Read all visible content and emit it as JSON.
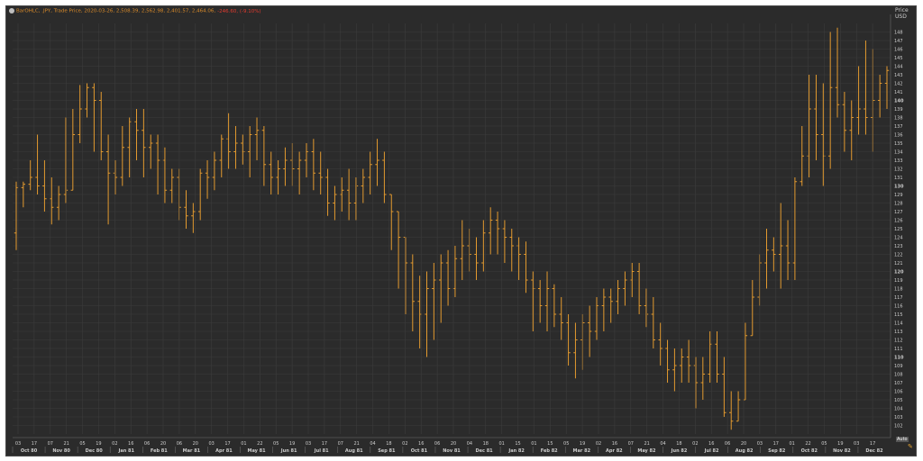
{
  "legend": {
    "instrument": "BarOHLC, .JPY, Trade Price, 2020-03-26, 2,508.39, 2,562.98, 2,401.57, 2,464.06,",
    "change": "-246.60, (-9.10%)"
  },
  "price_axis": {
    "title": "Price",
    "currency": "USD"
  },
  "scale_tag": "Auto",
  "colors": {
    "background": "#2b2b2b",
    "grid": "#3c3c3c",
    "bars": "#e39a2f",
    "text": "#cccccc",
    "change": "#e23b2e"
  },
  "chart_data": {
    "type": "ohlc",
    "title": "",
    "xlabel": "",
    "ylabel": "Price",
    "ylim": [
      101,
      149
    ],
    "yticks": [
      102,
      103,
      104,
      105,
      106,
      107,
      108,
      109,
      110,
      111,
      112,
      113,
      114,
      115,
      116,
      117,
      118,
      119,
      120,
      121,
      122,
      123,
      124,
      125,
      126,
      127,
      128,
      129,
      130,
      131,
      132,
      133,
      134,
      135,
      136,
      137,
      138,
      139,
      140,
      141,
      142,
      143,
      144,
      145,
      146,
      147,
      148
    ],
    "ytick_bold": [
      110,
      120,
      130,
      140
    ],
    "day_ticks": [
      "03",
      "17",
      "07",
      "21",
      "05",
      "19",
      "02",
      "16",
      "06",
      "20",
      "06",
      "20",
      "03",
      "17",
      "01",
      "22",
      "05",
      "19",
      "03",
      "17",
      "07",
      "21",
      "04",
      "18",
      "02",
      "16",
      "06",
      "20",
      "04",
      "18",
      "01",
      "15",
      "01",
      "15",
      "05",
      "19",
      "02",
      "16",
      "07",
      "21",
      "04",
      "18",
      "02",
      "16",
      "06",
      "20",
      "03",
      "17",
      "01",
      "22",
      "05",
      "19",
      "03",
      "17"
    ],
    "months": [
      "Oct 80",
      "Nov 80",
      "Dec 80",
      "Jan 81",
      "Feb 81",
      "Mar 81",
      "Apr 81",
      "May 81",
      "Jun 81",
      "Jul 81",
      "Aug 81",
      "Sep 81",
      "Oct 81",
      "Nov 81",
      "Dec 81",
      "Jan 82",
      "Feb 82",
      "Mar 82",
      "Apr 82",
      "May 82",
      "Jun 82",
      "Jul 82",
      "Aug 82",
      "Sep 82",
      "Oct 82",
      "Nov 82",
      "Dec 82"
    ],
    "bars": [
      [
        124.5,
        130.5,
        122.5,
        129.8
      ],
      [
        129.8,
        130.5,
        127.5,
        130.2
      ],
      [
        130.2,
        133,
        129.5,
        131
      ],
      [
        131,
        136,
        129,
        130
      ],
      [
        130,
        133,
        127,
        128.5
      ],
      [
        128.5,
        131,
        125.5,
        127.5
      ],
      [
        127.5,
        130,
        126,
        129
      ],
      [
        129,
        138,
        128,
        129.5
      ],
      [
        129.5,
        139,
        134,
        136
      ],
      [
        136,
        141.8,
        135,
        139
      ],
      [
        139,
        142,
        138,
        141.5
      ],
      [
        141.5,
        142,
        134,
        140
      ],
      [
        140,
        141,
        133,
        134
      ],
      [
        134,
        136,
        125.5,
        131.5
      ],
      [
        131.5,
        133,
        129,
        131
      ],
      [
        131,
        137,
        130,
        134.5
      ],
      [
        134.5,
        138,
        131,
        137.5
      ],
      [
        137.5,
        139,
        133,
        136.5
      ],
      [
        136.5,
        139,
        131,
        134.5
      ],
      [
        134.5,
        136,
        132,
        135
      ],
      [
        135,
        136,
        129,
        133
      ],
      [
        133,
        134.5,
        128,
        129.5
      ],
      [
        129.5,
        132,
        128,
        131
      ],
      [
        131,
        132,
        126,
        127.5
      ],
      [
        127.5,
        129.5,
        125,
        126.5
      ],
      [
        126.5,
        128,
        124.5,
        127
      ],
      [
        127,
        132,
        126,
        131.5
      ],
      [
        131.5,
        133,
        128.5,
        131
      ],
      [
        131,
        134,
        129.5,
        133
      ],
      [
        133,
        136,
        131,
        135.5
      ],
      [
        135.5,
        138.5,
        132,
        134
      ],
      [
        134,
        137,
        132,
        135
      ],
      [
        135,
        136,
        132.5,
        134
      ],
      [
        134,
        137,
        131,
        136
      ],
      [
        136,
        138,
        133,
        136.5
      ],
      [
        136.5,
        137,
        130,
        132.5
      ],
      [
        132.5,
        134,
        129,
        131
      ],
      [
        131,
        133,
        129,
        132
      ],
      [
        132,
        134.5,
        130,
        133
      ],
      [
        133,
        135,
        130,
        132
      ],
      [
        132,
        134,
        129,
        133
      ],
      [
        133,
        135,
        131,
        134
      ],
      [
        134,
        135.5,
        129.5,
        131.5
      ],
      [
        131.5,
        134,
        129,
        131
      ],
      [
        131,
        132,
        126.5,
        128
      ],
      [
        128,
        130,
        126,
        129
      ],
      [
        129,
        131,
        127,
        129.5
      ],
      [
        129.5,
        132,
        126,
        128
      ],
      [
        128,
        131,
        126,
        130
      ],
      [
        130,
        132,
        128,
        131
      ],
      [
        131,
        134,
        129,
        132.5
      ],
      [
        132.5,
        135.5,
        130,
        133
      ],
      [
        133,
        134,
        128,
        129
      ],
      [
        129,
        128.5,
        122.5,
        127
      ],
      [
        127,
        124.5,
        118,
        124
      ],
      [
        124,
        123,
        115,
        121
      ],
      [
        121,
        122,
        113,
        116.5
      ],
      [
        116.5,
        119.5,
        111,
        115
      ],
      [
        115,
        120,
        110,
        118
      ],
      [
        118,
        121,
        112,
        119
      ],
      [
        119,
        122,
        114,
        121
      ],
      [
        121,
        122.5,
        116,
        118
      ],
      [
        118,
        123,
        117,
        121.5
      ],
      [
        121.5,
        126,
        119,
        123
      ],
      [
        123,
        125,
        120,
        122
      ],
      [
        122,
        124,
        119,
        121
      ],
      [
        121,
        126,
        120,
        124.5
      ],
      [
        124.5,
        127.5,
        122,
        126
      ],
      [
        126,
        127,
        122,
        125
      ],
      [
        125,
        126,
        121,
        124
      ],
      [
        124,
        125,
        120,
        123
      ],
      [
        123,
        124,
        119,
        122
      ],
      [
        122,
        123.5,
        117.5,
        119
      ],
      [
        119,
        120,
        113,
        118
      ],
      [
        118,
        119,
        114,
        116
      ],
      [
        116,
        120,
        113,
        118
      ],
      [
        118,
        118.5,
        113.5,
        115
      ],
      [
        115,
        117,
        112,
        114
      ],
      [
        114,
        115,
        109,
        110.5
      ],
      [
        110.5,
        114,
        107.5,
        112
      ],
      [
        112,
        115,
        108.5,
        114
      ],
      [
        114,
        116,
        110,
        113
      ],
      [
        113,
        117,
        112,
        116
      ],
      [
        116,
        118,
        113,
        117
      ],
      [
        117,
        118,
        114,
        116.5
      ],
      [
        116.5,
        119,
        115,
        118
      ],
      [
        118,
        120,
        116,
        119
      ],
      [
        119,
        121,
        117,
        120
      ],
      [
        120,
        121,
        115,
        116
      ],
      [
        116,
        118,
        113.5,
        115
      ],
      [
        115,
        117,
        111,
        112
      ],
      [
        112,
        114,
        109,
        111
      ],
      [
        111,
        112,
        107,
        108.5
      ],
      [
        108.5,
        111,
        106,
        109
      ],
      [
        109,
        111,
        107,
        110
      ],
      [
        110,
        112,
        107,
        109
      ],
      [
        109,
        110,
        104,
        107
      ],
      [
        107,
        110,
        105,
        108
      ],
      [
        108,
        113,
        107,
        111.5
      ],
      [
        111.5,
        113,
        107,
        108
      ],
      [
        108,
        110,
        103,
        103.5
      ],
      [
        103.5,
        106,
        101.5,
        102.5
      ],
      [
        102.5,
        106,
        103,
        105
      ],
      [
        105,
        114,
        112,
        112.5
      ],
      [
        112.5,
        119,
        114,
        117
      ],
      [
        117,
        122,
        116,
        121
      ],
      [
        121,
        125,
        118,
        122.5
      ],
      [
        122.5,
        124,
        120,
        122
      ],
      [
        122,
        128,
        118,
        123
      ],
      [
        123,
        126,
        119,
        121
      ],
      [
        121,
        131,
        119,
        130.5
      ],
      [
        130.5,
        137,
        130,
        133.5
      ],
      [
        133.5,
        143,
        131,
        139
      ],
      [
        139,
        143,
        133,
        136
      ],
      [
        136,
        142,
        130,
        133.5
      ],
      [
        133.5,
        148,
        132,
        141.5
      ],
      [
        141.5,
        148.5,
        138,
        139.5
      ],
      [
        139.5,
        141,
        134,
        136.5
      ],
      [
        136.5,
        140,
        133,
        138
      ],
      [
        138,
        144,
        136,
        139
      ],
      [
        139,
        147,
        136,
        138
      ],
      [
        138,
        146,
        134,
        140
      ],
      [
        140,
        143,
        138,
        142
      ],
      [
        142,
        144,
        139,
        143.5
      ]
    ]
  }
}
